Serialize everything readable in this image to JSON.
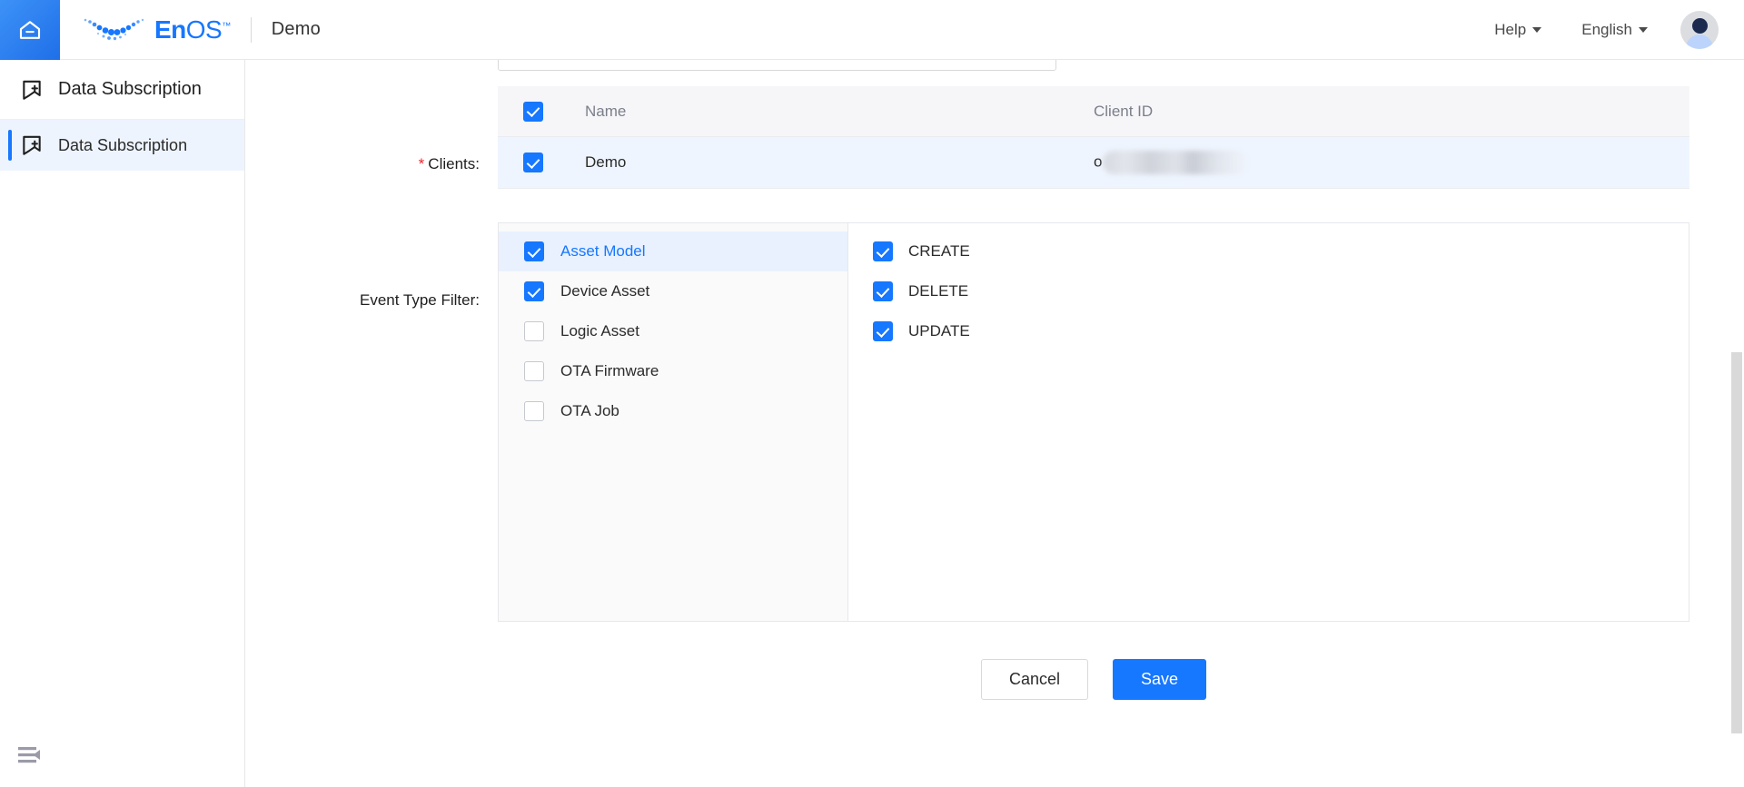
{
  "topbar": {
    "home_icon": "home-icon",
    "brand_en": "En",
    "brand_os": "OS",
    "brand_tm": "™",
    "app_name": "Demo",
    "help_label": "Help",
    "language_label": "English",
    "avatar_alt": "user-avatar"
  },
  "sidebar": {
    "header_label": "Data Subscription",
    "header_icon": "bookmark-plus-icon",
    "items": [
      {
        "label": "Data Subscription",
        "icon": "bookmark-plus-icon",
        "active": true
      }
    ],
    "collapse_icon": "collapse-sidebar-icon"
  },
  "form": {
    "clients": {
      "label": "Clients",
      "required_mark": "*",
      "colon": ":",
      "select_all_checked": true,
      "columns": [
        "Name",
        "Client ID"
      ],
      "rows": [
        {
          "checked": true,
          "name": "Demo",
          "client_id_prefix": "o",
          "client_id_redacted": true
        }
      ]
    },
    "event_type_filter": {
      "label": "Event Type Filter",
      "colon": ":",
      "categories": [
        {
          "label": "Asset Model",
          "checked": true,
          "active": true
        },
        {
          "label": "Device Asset",
          "checked": true,
          "active": false
        },
        {
          "label": "Logic Asset",
          "checked": false,
          "active": false
        },
        {
          "label": "OTA Firmware",
          "checked": false,
          "active": false
        },
        {
          "label": "OTA Job",
          "checked": false,
          "active": false
        }
      ],
      "actions": [
        {
          "label": "CREATE",
          "checked": true
        },
        {
          "label": "DELETE",
          "checked": true
        },
        {
          "label": "UPDATE",
          "checked": true
        }
      ]
    },
    "buttons": {
      "cancel": "Cancel",
      "save": "Save"
    }
  },
  "colors": {
    "accent": "#1677ff",
    "required": "#f5222d",
    "active_row": "#e9f1fe",
    "table_header": "#f6f6f9",
    "panel_bg": "#fafafa"
  }
}
